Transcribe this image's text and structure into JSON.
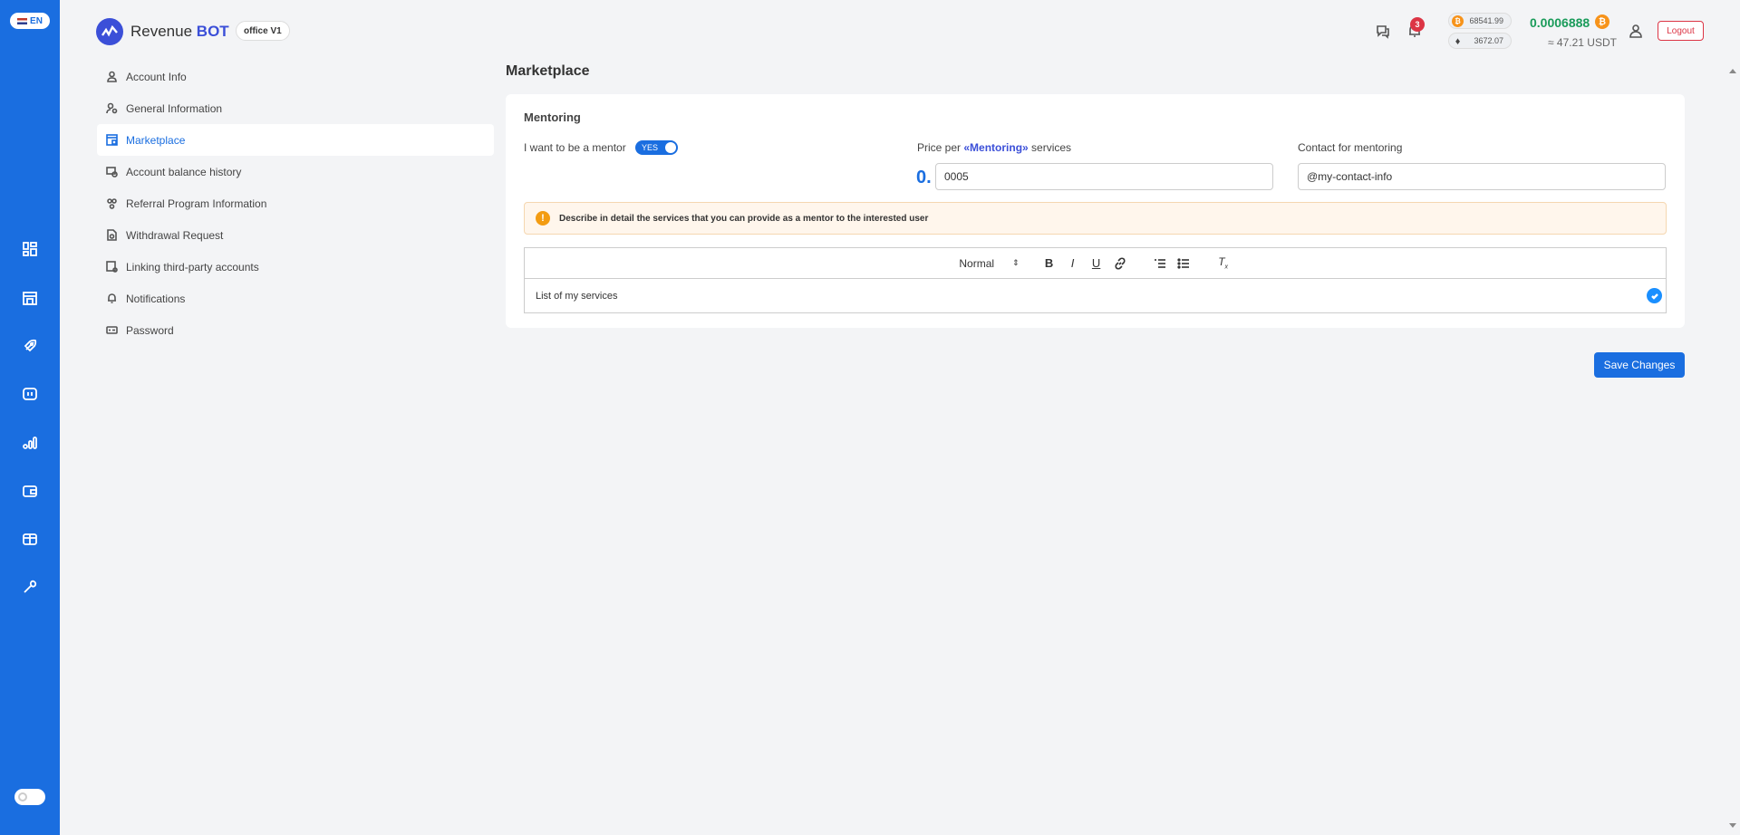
{
  "rail": {
    "lang": "EN",
    "icons": [
      "dashboard-icon",
      "store-icon",
      "rocket-icon",
      "bot-icon",
      "chart-icon",
      "wallet-icon",
      "gift-icon",
      "tools-icon"
    ]
  },
  "header": {
    "brand_prefix": "Revenue",
    "brand_suffix": "BOT",
    "office": "office V1",
    "notifications_count": "3",
    "btc_price": "68541.99",
    "eth_price": "3672.07",
    "balance": "0.0006888",
    "balance_usdt": "≈ 47.21 USDT",
    "logout": "Logout"
  },
  "subnav": {
    "items": [
      {
        "label": "Account Info",
        "icon": "user-icon"
      },
      {
        "label": "General Information",
        "icon": "user-gear-icon"
      },
      {
        "label": "Marketplace",
        "icon": "marketplace-icon"
      },
      {
        "label": "Account balance history",
        "icon": "money-history-icon"
      },
      {
        "label": "Referral Program Information",
        "icon": "referral-icon"
      },
      {
        "label": "Withdrawal Request",
        "icon": "withdraw-icon"
      },
      {
        "label": "Linking third-party accounts",
        "icon": "link-accounts-icon"
      },
      {
        "label": "Notifications",
        "icon": "bell-icon"
      },
      {
        "label": "Password",
        "icon": "password-icon"
      }
    ],
    "active": "Marketplace"
  },
  "main": {
    "title": "Marketplace",
    "section_title": "Mentoring",
    "mentor_label": "I want to be a mentor",
    "toggle_label": "YES",
    "price_label_prefix": "Price per ",
    "price_label_highlight": "«Mentoring»",
    "price_label_suffix": " services",
    "price_prefix": "0.",
    "price_value": "0005",
    "contact_label": "Contact for mentoring",
    "contact_value": "@my-contact-info",
    "alert_text": "Describe in detail the services that you can provide as a mentor to the interested user",
    "editor_format": "Normal",
    "editor_content": "List of my services",
    "save_label": "Save Changes"
  },
  "colors": {
    "primary": "#1a6ee0",
    "balance": "#1a9b5a",
    "danger": "#dc3545",
    "warning": "#f39c12"
  }
}
